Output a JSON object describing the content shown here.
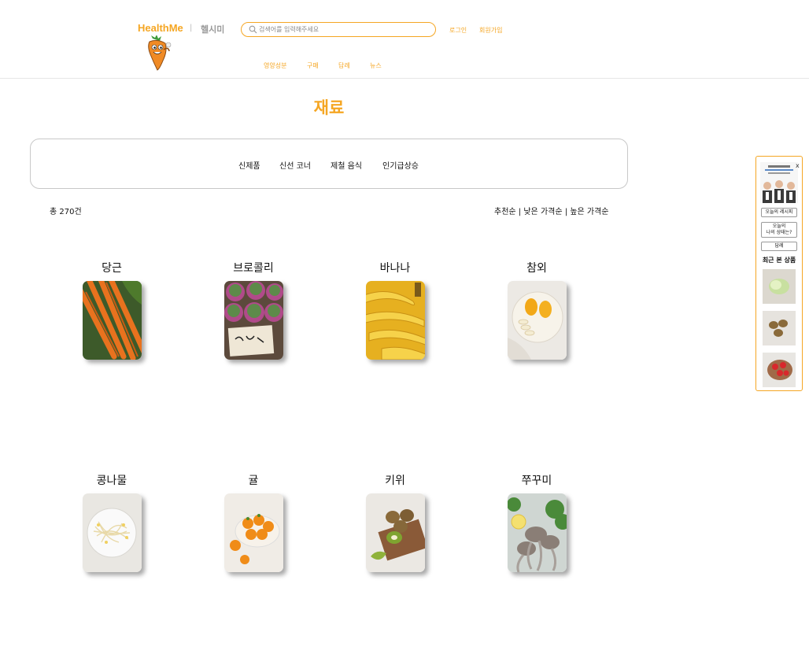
{
  "header": {
    "brand": "HealthMe",
    "separator": "|",
    "brand_korean": "헬시미",
    "search_placeholder": "검색어를 입력해주세요",
    "login": "로그인",
    "signup": "회원가입",
    "nav": [
      "영양성분",
      "구매",
      "답례",
      "뉴스"
    ]
  },
  "page": {
    "title": "재료",
    "categories": [
      "신제품",
      "신선 코너",
      "제철 음식",
      "인기급상승"
    ],
    "count": "총 270건",
    "sort": [
      "추천순",
      "낮은 가격순",
      "높은 가격순"
    ],
    "sort_separator": "|"
  },
  "products": [
    {
      "name": "당근",
      "icon": "carrot-image"
    },
    {
      "name": "브로콜리",
      "icon": "broccoli-image"
    },
    {
      "name": "바나나",
      "icon": "banana-image"
    },
    {
      "name": "참외",
      "icon": "korean-melon-image"
    },
    {
      "name": "콩나물",
      "icon": "bean-sprouts-image"
    },
    {
      "name": "귤",
      "icon": "tangerine-image"
    },
    {
      "name": "키위",
      "icon": "kiwi-image"
    },
    {
      "name": "쭈꾸미",
      "icon": "webfoot-octopus-image"
    }
  ],
  "side": {
    "close": "x",
    "buttons": [
      "오늘의 레시피",
      "오늘의\n나의 상태는?",
      "답례"
    ],
    "recent_title": "최근 본 상품"
  },
  "colors": {
    "accent": "#f5a623",
    "border": "#c8c8c8"
  }
}
